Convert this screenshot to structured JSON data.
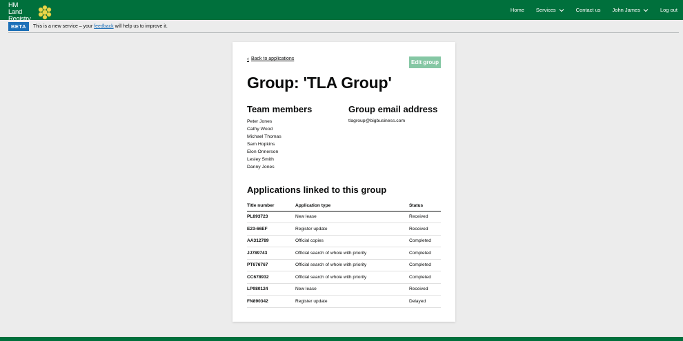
{
  "header": {
    "logo_line1": "HM Land",
    "logo_line2": "Registry",
    "nav": {
      "home": "Home",
      "services": "Services",
      "contact": "Contact us",
      "user": "John James",
      "logout": "Log out"
    }
  },
  "beta": {
    "tag": "BETA",
    "text_before": "This is a new service – your",
    "link": "feedback",
    "text_after": "will help us to improve it."
  },
  "card": {
    "back_label": "Back to applications",
    "edit_label": "Edit group",
    "title": "Group: 'TLA Group'",
    "members_heading": "Team members",
    "members": [
      "Peter Jones",
      "Cathy Wood",
      "Michael Thomas",
      "Sam Hopkins",
      "Elon Onnerson",
      "Lesley Smith",
      "Danny Jones"
    ],
    "email_heading": "Group email address",
    "email": "tlagroup@bigbusiness.com",
    "apps_heading": "Applications linked to this group",
    "table": {
      "headers": [
        "Title number",
        "Application type",
        "Status"
      ],
      "rows": [
        [
          "PL893723",
          "New lease",
          "Received"
        ],
        [
          "E23-66EF",
          "Register update",
          "Received"
        ],
        [
          "AA312789",
          "Official copies",
          "Completed"
        ],
        [
          "JJ789743",
          "Official search of whole with priority",
          "Completed"
        ],
        [
          "PT676767",
          "Official search of whole with priority",
          "Completed"
        ],
        [
          "CC678932",
          "Official search of whole with priority",
          "Completed"
        ],
        [
          "LP980124",
          "New lease",
          "Received"
        ],
        [
          "FN890342",
          "Register update",
          "Delayed"
        ]
      ]
    }
  }
}
